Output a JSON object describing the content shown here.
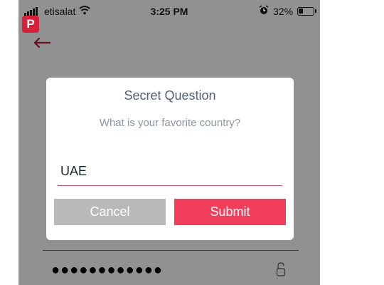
{
  "status_bar": {
    "carrier": "etisalat",
    "time": "3:25 PM",
    "battery_percent": "32%",
    "battery_level": 0.32,
    "icons": [
      "signal-bars-icon",
      "wifi-icon",
      "alarm-clock-icon",
      "battery-icon"
    ]
  },
  "brand_badge": {
    "letter": "P",
    "color": "#d8203a"
  },
  "back_button": {
    "icon": "back-arrow-icon",
    "color": "#b01e3a"
  },
  "dialog": {
    "title": "Secret Question",
    "question": "What is your favorite country?",
    "answer_value": "UAE",
    "cancel_label": "Cancel",
    "submit_label": "Submit",
    "cancel_color": "#b9b9b9",
    "submit_color": "#f03e5c"
  },
  "password_field": {
    "masked_value": "●●●●●●●●●●●●",
    "icon": "lock-icon"
  }
}
